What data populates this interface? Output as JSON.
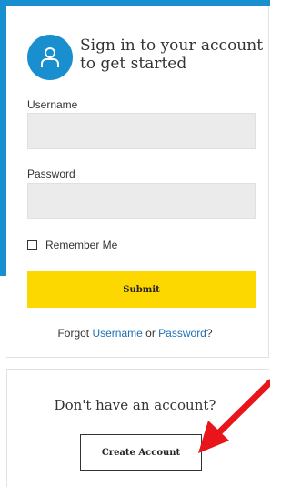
{
  "header": {
    "title": "Sign in to your account to get started",
    "icon": "user-icon"
  },
  "form": {
    "username_label": "Username",
    "username_value": "",
    "password_label": "Password",
    "password_value": "",
    "remember_label": "Remember Me",
    "remember_checked": false,
    "submit_label": "Submit"
  },
  "forgot": {
    "prefix": "Forgot ",
    "username_link": "Username",
    "middle": " or ",
    "password_link": "Password",
    "suffix": "?"
  },
  "signup": {
    "prompt": "Don't have an account?",
    "button_label": "Create Account"
  },
  "colors": {
    "accent": "#1a8fd0",
    "submit": "#fdd700",
    "link": "#1f6fb5",
    "arrow": "#e8161a"
  }
}
